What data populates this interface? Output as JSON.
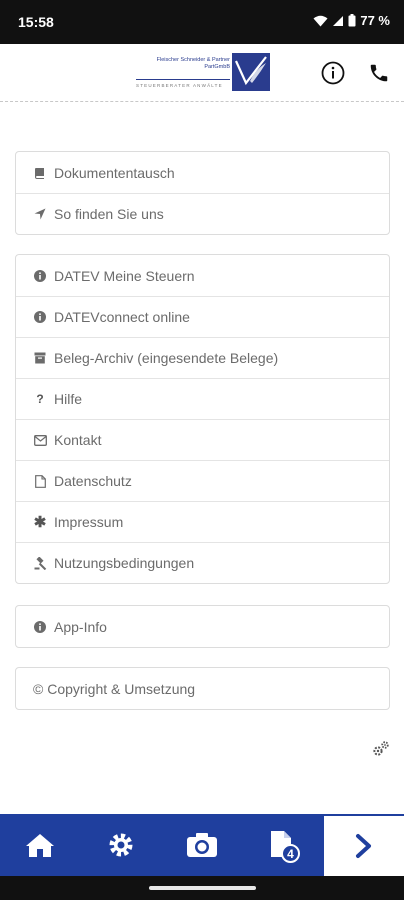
{
  "status_bar": {
    "time": "15:58",
    "battery": "77 %",
    "icons": [
      "wifi-icon",
      "signal-icon",
      "battery-icon"
    ]
  },
  "header": {
    "logo_lines": [
      "Fleischer Schneider & Partner",
      "PartGmbB"
    ],
    "logo_subtitle": "STEUERBERATER  ANWÄLTE",
    "info_icon": "info-circle-icon",
    "phone_icon": "phone-icon"
  },
  "menu": {
    "group1": [
      {
        "label": "Dokumententausch",
        "icon": "book-icon"
      },
      {
        "label": "So finden Sie uns",
        "icon": "location-arrow-icon"
      }
    ],
    "group2": [
      {
        "label": "DATEV Meine Steuern",
        "icon": "info-circle-icon"
      },
      {
        "label": "DATEVconnect online",
        "icon": "info-circle-icon"
      },
      {
        "label": "Beleg-Archiv (eingesendete Belege)",
        "icon": "archive-icon"
      },
      {
        "label": "Hilfe",
        "icon": "question-icon"
      },
      {
        "label": "Kontakt",
        "icon": "envelope-icon"
      },
      {
        "label": "Datenschutz",
        "icon": "file-icon"
      },
      {
        "label": "Impressum",
        "icon": "asterisk-icon"
      },
      {
        "label": "Nutzungsbedingungen",
        "icon": "gavel-icon"
      }
    ],
    "group3": [
      {
        "label": "App-Info",
        "icon": "info-circle-icon"
      }
    ],
    "group4": [
      {
        "label": "© Copyright & Umsetzung",
        "icon": ""
      }
    ]
  },
  "bottom_nav": {
    "tabs": [
      "home-icon",
      "gear-icon",
      "camera-icon",
      "document-icon",
      "chevron-right-icon"
    ],
    "document_badge": "4"
  },
  "colors": {
    "brand_blue": "#1f3f9e",
    "text_gray": "#6b6b6b",
    "border": "#dcdcdc"
  }
}
